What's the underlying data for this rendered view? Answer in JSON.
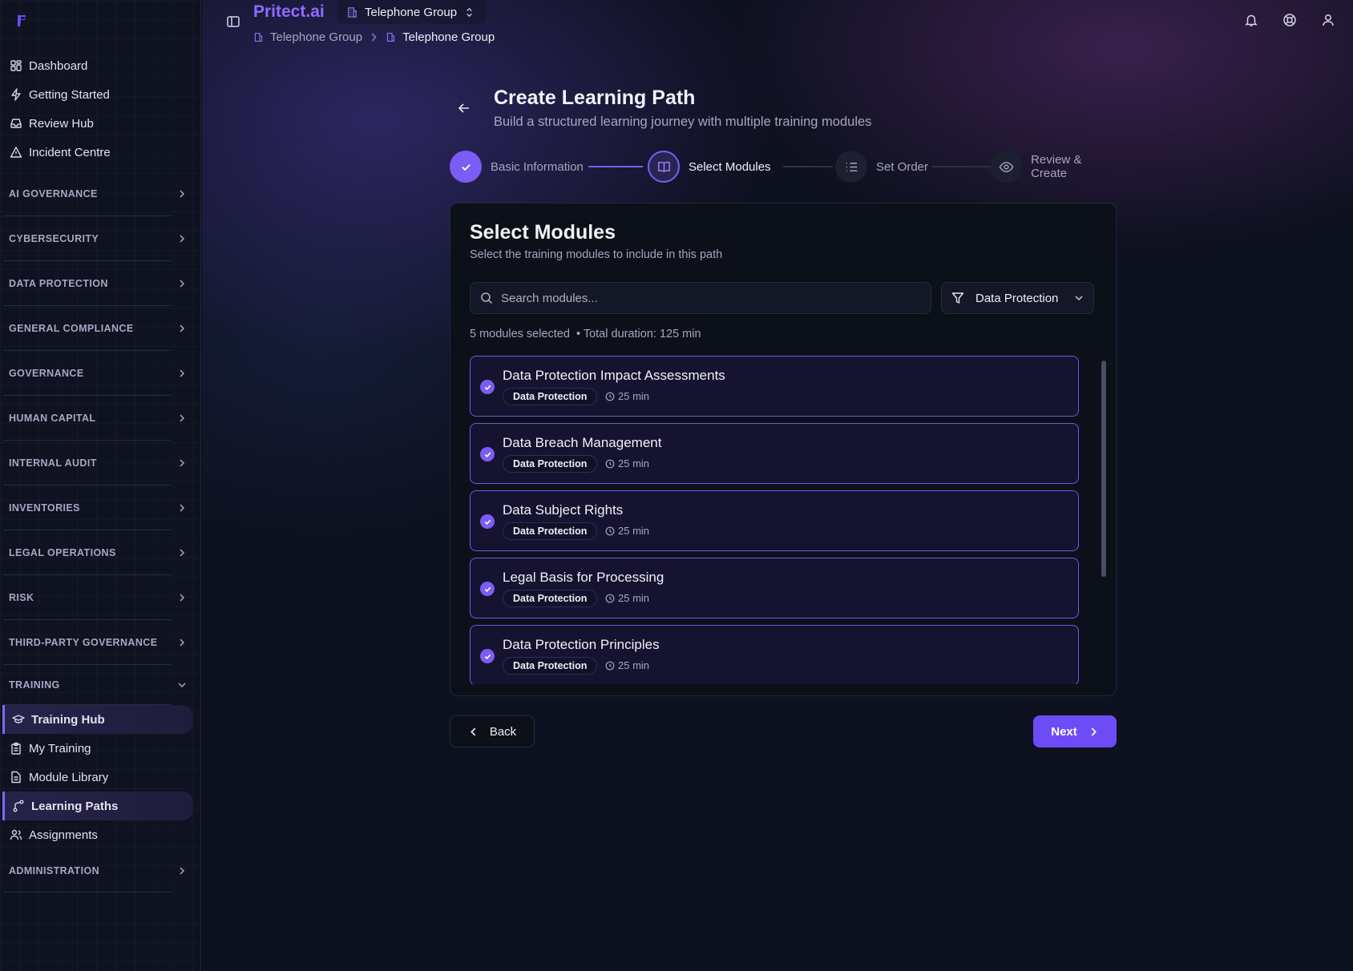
{
  "app": {
    "brand": "Pritect.ai"
  },
  "org_switcher": {
    "label": "Telephone Group"
  },
  "breadcrumb": [
    "Telephone Group",
    "Telephone Group"
  ],
  "sidebar": {
    "top_items": [
      {
        "label": "Dashboard",
        "icon": "dashboard-icon"
      },
      {
        "label": "Getting Started",
        "icon": "lightning-icon"
      },
      {
        "label": "Review Hub",
        "icon": "inbox-icon"
      },
      {
        "label": "Incident Centre",
        "icon": "warning-icon"
      }
    ],
    "sections": [
      "AI GOVERNANCE",
      "CYBERSECURITY",
      "DATA PROTECTION",
      "GENERAL COMPLIANCE",
      "GOVERNANCE",
      "HUMAN CAPITAL",
      "INTERNAL AUDIT",
      "INVENTORIES",
      "LEGAL OPERATIONS",
      "RISK",
      "THIRD-PARTY GOVERNANCE"
    ],
    "training": {
      "title": "TRAINING",
      "items": [
        {
          "label": "Training Hub",
          "icon": "graduation-cap-icon",
          "active": true
        },
        {
          "label": "My Training",
          "icon": "clipboard-icon",
          "active": false
        },
        {
          "label": "Module Library",
          "icon": "file-icon",
          "active": false
        },
        {
          "label": "Learning Paths",
          "icon": "route-icon",
          "active": true
        },
        {
          "label": "Assignments",
          "icon": "users-icon",
          "active": false
        }
      ]
    },
    "administration": "ADMINISTRATION"
  },
  "page": {
    "title": "Create Learning Path",
    "subtitle": "Build a structured learning journey with multiple training modules"
  },
  "stepper": [
    {
      "label": "Basic Information",
      "state": "done"
    },
    {
      "label": "Select Modules",
      "state": "current"
    },
    {
      "label": "Set Order",
      "state": "todo"
    },
    {
      "label": "Review & Create",
      "state": "todo"
    }
  ],
  "card": {
    "title": "Select Modules",
    "subtitle": "Select the training modules to include in this path",
    "search_placeholder": "Search modules...",
    "filter_value": "Data Protection",
    "selected_count": "5 modules selected",
    "total_duration": "• Total duration: 125 min"
  },
  "modules": [
    {
      "title": "Data Protection Impact Assessments",
      "category": "Data Protection",
      "duration": "25 min",
      "selected": true
    },
    {
      "title": "Data Breach Management",
      "category": "Data Protection",
      "duration": "25 min",
      "selected": true
    },
    {
      "title": "Data Subject Rights",
      "category": "Data Protection",
      "duration": "25 min",
      "selected": true
    },
    {
      "title": "Legal Basis for Processing",
      "category": "Data Protection",
      "duration": "25 min",
      "selected": true
    },
    {
      "title": "Data Protection Principles",
      "category": "Data Protection",
      "duration": "25 min",
      "selected": true
    }
  ],
  "actions": {
    "back": "Back",
    "next": "Next"
  },
  "colors": {
    "accent": "#7b5cf5",
    "brand": "#8d6cff",
    "background": "#0e1120"
  }
}
